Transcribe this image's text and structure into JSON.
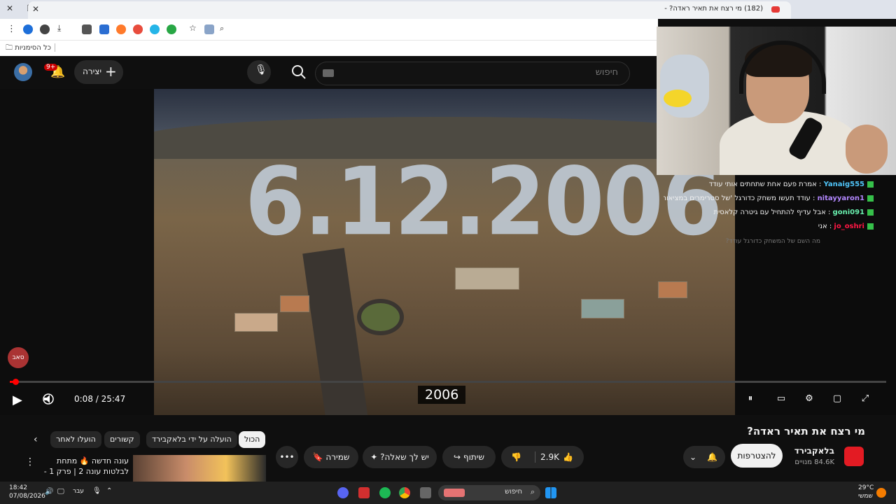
{
  "browser": {
    "tab_title": "(182) מי רצח את תאיר ראדה? -",
    "bookmarks_label": "כל הסימניות"
  },
  "youtube": {
    "search_placeholder": "חיפוש",
    "create_label": "יצירה",
    "notif_count": "9+"
  },
  "video": {
    "overlay_date": "6.12.2006",
    "caption": "2006",
    "current_time": "0:08 / 25:47",
    "progress": 0.005,
    "title": "מי רצח את תאיר ראדה?",
    "logo_text": "סאב"
  },
  "chat": [
    {
      "user": "Yanaig555",
      "user_color": "#4fc3f7",
      "message": "אמרת פעם אחת שתחתים אותי עודד"
    },
    {
      "user": "nitayyaron1",
      "user_color": "#b388ff",
      "message": "עודד תעשו משחק כדורגל 'של סטרימרים במציאות"
    },
    {
      "user": "goni091",
      "user_color": "#69f0ae",
      "message": "אבל עדיף להתחיל עם גיטרה קלאסית"
    },
    {
      "user": "jo_oshri",
      "user_color": "#ff1744",
      "message": "אני"
    },
    {
      "user": "",
      "user_color": "#888888",
      "message": "מה השם של המשחק כדורגל עודד?"
    }
  ],
  "channel": {
    "name": "בלאקבירד",
    "subs": "84.6K מנויים",
    "subscribe_label": "להצטרפות"
  },
  "actions": {
    "likes": "2.9K",
    "share": "שיתוף",
    "ask": "יש לך שאלה?",
    "save": "שמירה"
  },
  "chips": [
    "הכול",
    "הועלה על ידי בלאקבירד",
    "קשורים",
    "הועלו לאחר"
  ],
  "recommended": {
    "title_line1": "עונה חדשה 🔥 מתחת",
    "title_line2": "לבלטות עונה 2 | פרק 1 - ..."
  },
  "taskbar": {
    "time": "18:42",
    "date": "07/08/2026",
    "lang": "עבר",
    "search": "חיפוש",
    "temp": "29°C",
    "weather": "שמשי"
  }
}
